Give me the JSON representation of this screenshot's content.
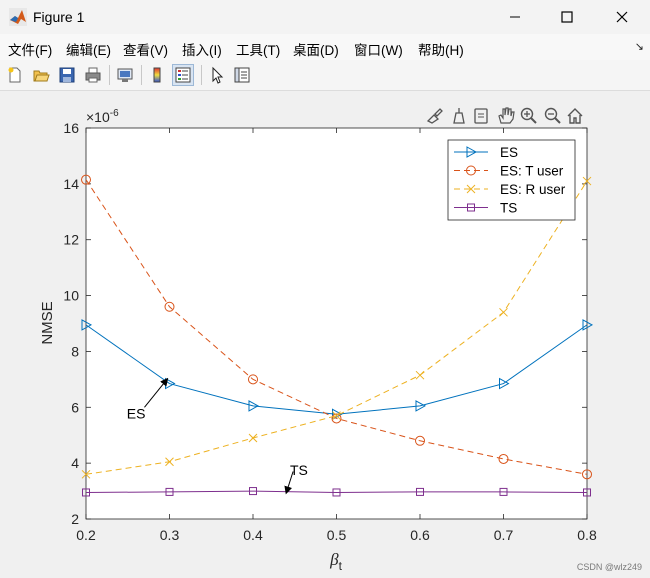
{
  "window": {
    "title": "Figure 1"
  },
  "menu": [
    "文件(F)",
    "编辑(E)",
    "查看(V)",
    "插入(I)",
    "工具(T)",
    "桌面(D)",
    "窗口(W)",
    "帮助(H)"
  ],
  "toolbar": {
    "icons": [
      "new-figure-icon",
      "open-file-icon",
      "save-icon",
      "print-icon",
      "link-plot-icon",
      "colorbar-icon",
      "legend-icon",
      "edit-plot-icon",
      "property-inspector-icon"
    ]
  },
  "axes_toolbar": {
    "icons": [
      "brush-icon",
      "data-tips-icon",
      "rotate-icon",
      "pan-icon",
      "zoom-in-icon",
      "zoom-out-icon",
      "home-icon"
    ]
  },
  "chart_data": {
    "type": "line",
    "x": [
      0.2,
      0.3,
      0.4,
      0.5,
      0.6,
      0.7,
      0.8
    ],
    "xlabel_base": "β",
    "xlabel_sub": "t",
    "ylabel": "NMSE",
    "exponent_label": "×10",
    "exponent_power": "-6",
    "xlim": [
      0.2,
      0.8
    ],
    "ylim": [
      2,
      16
    ],
    "xticks": [
      "0.2",
      "0.3",
      "0.4",
      "0.5",
      "0.6",
      "0.7",
      "0.8"
    ],
    "yticks": [
      "2",
      "4",
      "6",
      "8",
      "10",
      "12",
      "14",
      "16"
    ],
    "series": [
      {
        "name": "ES",
        "values": [
          8.95,
          6.85,
          6.05,
          5.75,
          6.05,
          6.85,
          8.95
        ],
        "color": "#0072BD",
        "dash": "solid",
        "marker": "triangle-right"
      },
      {
        "name": "ES: T user",
        "values": [
          14.15,
          9.6,
          7.0,
          5.6,
          4.8,
          4.15,
          3.6
        ],
        "color": "#D95319",
        "dash": "dashed",
        "marker": "circle"
      },
      {
        "name": "ES: R user",
        "values": [
          3.6,
          4.05,
          4.9,
          5.7,
          7.15,
          9.4,
          14.1
        ],
        "color": "#EDB120",
        "dash": "dashed",
        "marker": "x"
      },
      {
        "name": "TS",
        "values": [
          2.95,
          2.97,
          3.0,
          2.95,
          2.97,
          2.97,
          2.95
        ],
        "color": "#7E2F8E",
        "dash": "solid",
        "marker": "square"
      }
    ],
    "annotations": [
      {
        "text": "ES",
        "x": 0.26,
        "y": 5.6,
        "arrow_from": [
          0.27,
          6.0
        ],
        "arrow_to": [
          0.297,
          7.0
        ]
      },
      {
        "text": "TS",
        "x": 0.455,
        "y": 3.58,
        "arrow_from": [
          0.448,
          3.7
        ],
        "arrow_to": [
          0.44,
          2.95
        ]
      }
    ],
    "legend_position": "top-right",
    "grid": false
  },
  "watermark": "CSDN @wlz249"
}
